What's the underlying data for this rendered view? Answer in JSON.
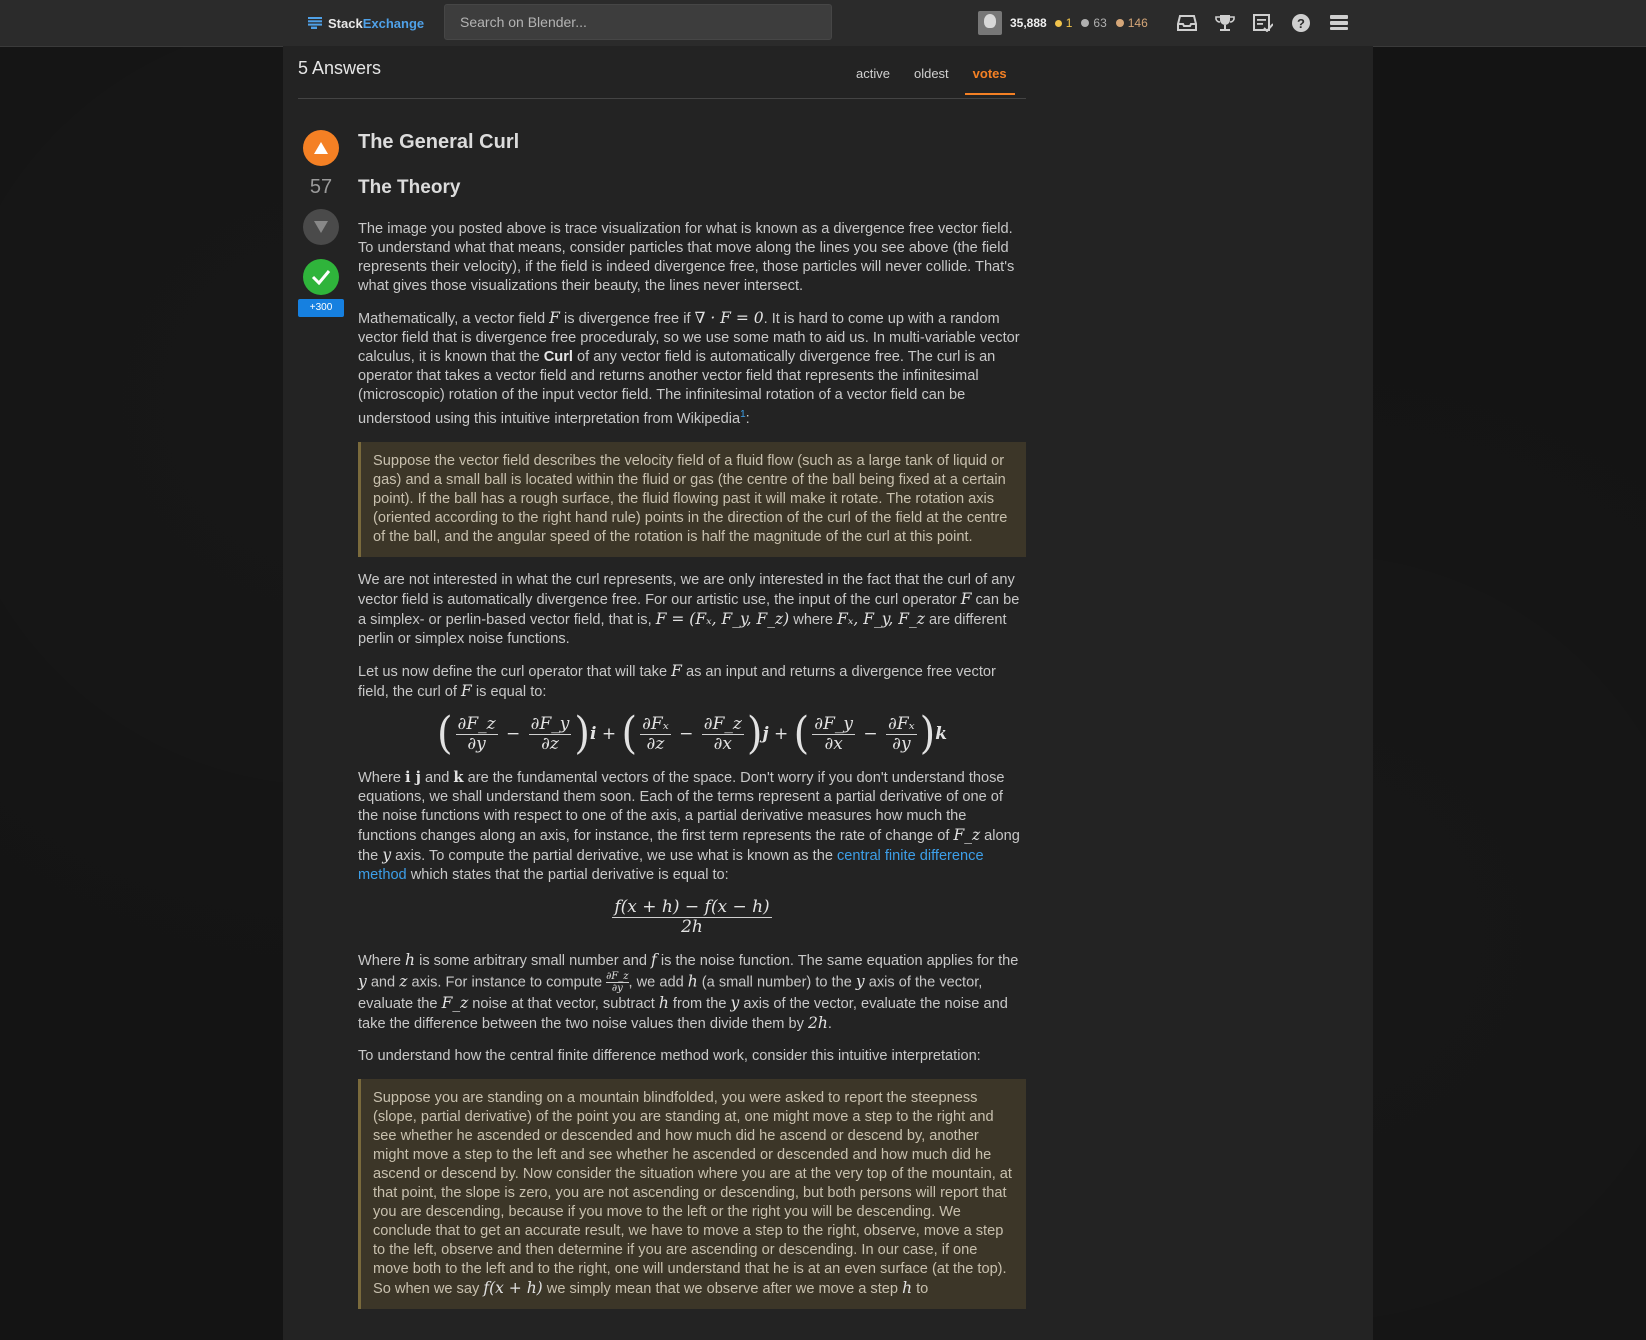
{
  "header": {
    "logo_stack": "Stack",
    "logo_exchange": "Exchange",
    "search_placeholder": "Search on Blender...",
    "reputation": "35,888",
    "gold_badges": "1",
    "silver_badges": "63",
    "bronze_badges": "146",
    "icons": [
      "inbox-icon",
      "achievements-icon",
      "review-icon",
      "help-icon",
      "site-switcher-icon"
    ]
  },
  "answers": {
    "count_label": "5 Answers",
    "sort_tabs": [
      "active",
      "oldest",
      "votes"
    ],
    "active_tab": "votes"
  },
  "answer": {
    "score": "57",
    "bounty": "+300",
    "title": "The General Curl",
    "subtitle": "The Theory",
    "p1": "The image you posted above is trace visualization for what is known as a divergence free vector field. To understand what that means, consider particles that move along the lines you see above (the field represents their velocity), if the field is indeed divergence free, those particles will never collide. That's what gives those visualizations their beauty, the lines never intersect.",
    "p2_a": "Mathematically, a vector field ",
    "p2_F": "F",
    "p2_b": " is divergence free if ",
    "p2_eq": "∇ · F = 0",
    "p2_c": ". It is hard to come up with a random vector field that is divergence free proceduraly, so we use some math to aid us. In multi-variable vector calculus, it is known that the ",
    "p2_curl": "Curl",
    "p2_d": " of any vector field is automatically divergence free. The curl is an operator that takes a vector field and returns another vector field that represents the infinitesimal (microscopic) rotation of the input vector field. The infinitesimal rotation of a vector field can be understood using this intuitive interpretation from Wikipedia",
    "p2_sup": "1",
    "p2_e": ":",
    "quote1": "Suppose the vector field describes the velocity field of a fluid flow (such as a large tank of liquid or gas) and a small ball is located within the fluid or gas (the centre of the ball being fixed at a certain point). If the ball has a rough surface, the fluid flowing past it will make it rotate. The rotation axis (oriented according to the right hand rule) points in the direction of the curl of the field at the centre of the ball, and the angular speed of the rotation is half the magnitude of the curl at this point.",
    "p3_a": "We are not interested in what the curl represents, we are only interested in the fact that the curl of any vector field is automatically divergence free. For our artistic use, the input of the curl operator ",
    "p3_F": "F",
    "p3_b": " can be a simplex- or perlin-based vector field, that is, ",
    "p3_eq": "F = (Fₓ, F_y, F_z)",
    "p3_c": " where ",
    "p3_comps": "Fₓ, F_y, F_z",
    "p3_d": " are different perlin or simplex noise functions.",
    "p4_a": "Let us now define the curl operator that will take ",
    "p4_F": "F",
    "p4_b": " as an input and returns a divergence free vector field, the curl of ",
    "p4_F2": "F",
    "p4_c": " is equal to:",
    "curl_eq": {
      "t1_num_a": "∂F_z",
      "t1_den_a": "∂y",
      "t1_num_b": "∂F_y",
      "t1_den_b": "∂z",
      "t1_vec": "i",
      "t2_num_a": "∂Fₓ",
      "t2_den_a": "∂z",
      "t2_num_b": "∂F_z",
      "t2_den_b": "∂x",
      "t2_vec": "j",
      "t3_num_a": "∂F_y",
      "t3_den_a": "∂x",
      "t3_num_b": "∂Fₓ",
      "t3_den_b": "∂y",
      "t3_vec": "k"
    },
    "p5_a": "Where ",
    "p5_ij": "i j",
    "p5_b": " and ",
    "p5_k": "k",
    "p5_c": " are the fundamental vectors of the space. Don't worry if you don't understand those equations, we shall understand them soon. Each of the terms represent a partial derivative of one of the noise functions with respect to one of the axis, a partial derivative measures how much the functions changes along an axis, for instance, the first term represents the rate of change of ",
    "p5_Fz": "F_z",
    "p5_d": " along the ",
    "p5_y": "y",
    "p5_e": " axis. To compute the partial derivative, we use what is known as the ",
    "p5_link": "central finite difference method",
    "p5_f": " which states that the partial derivative is equal to:",
    "fd_num": "f(x + h) − f(x − h)",
    "fd_den": "2h",
    "p6_a": "Where ",
    "p6_h": "h",
    "p6_b": " is some arbitrary small number and ",
    "p6_f": "f",
    "p6_c": " is the noise function. The same equation applies for the ",
    "p6_y": "y",
    "p6_d": " and ",
    "p6_z": "z",
    "p6_e": " axis. For instance to compute ",
    "p6_frac_num": "∂F_z",
    "p6_frac_den": "∂y",
    "p6_f2": ", we add ",
    "p6_h2": "h",
    "p6_g": " (a small number) to the ",
    "p6_y2": "y",
    "p6_h3": " axis of the vector, evaluate the ",
    "p6_Fz": "F_z",
    "p6_i": " noise at that vector, subtract ",
    "p6_h4": "h",
    "p6_j": " from the ",
    "p6_y3": "y",
    "p6_k": " axis of the vector, evaluate the noise and take the difference between the two noise values then divide them by ",
    "p6_2h": "2h",
    "p6_l": ".",
    "p7": "To understand how the central finite difference method work, consider this intuitive interpretation:",
    "quote2_a": "Suppose you are standing on a mountain blindfolded, you were asked to report the steepness (slope, partial derivative) of the point you are standing at, one might move a step to the right and see whether he ascended or descended and how much did he ascend or descend by, another might move a step to the left and see whether he ascended or descended and how much did he ascend or descend by. Now consider the situation where you are at the very top of the mountain, at that point, the slope is zero, you are not ascending or descending, but both persons will report that you are descending, because if you move to the left or the right you will be descending. We conclude that to get an accurate result, we have to move a step to the right, observe, move a step to the left, observe and then determine if you are ascending or descending. In our case, if one move both to the left and to the right, one will understand that he is at an even surface (at the top). So when we say ",
    "quote2_eq": "f(x + h)",
    "quote2_b": " we simply mean that we observe after we move a step ",
    "quote2_h": "h",
    "quote2_c": " to"
  }
}
